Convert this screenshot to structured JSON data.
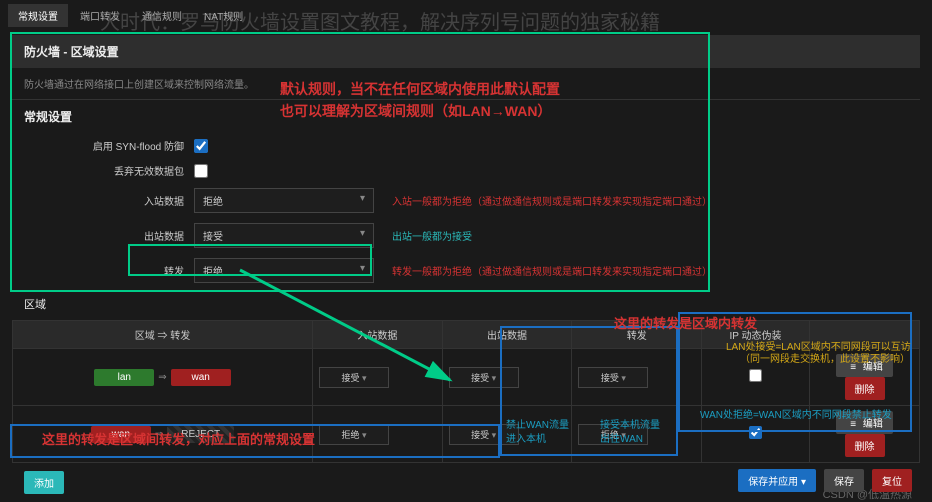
{
  "page_title_bg": "大时代：罗马防火墙设置图文教程，解决序列号问题的独家秘籍",
  "tabs": {
    "t0": "常规设置",
    "t1": "端口转发",
    "t2": "通信规则",
    "t3": "NAT规则"
  },
  "panel": {
    "title": "防火墙 - 区域设置",
    "desc": "防火墙通过在网络接口上创建区域来控制网络流量。"
  },
  "sub": "常规设置",
  "form": {
    "syn_label": "启用 SYN-flood 防御",
    "syn_checked": true,
    "drop_label": "丢弃无效数据包",
    "drop_checked": false,
    "in_label": "入站数据",
    "in_val": "拒绝",
    "out_label": "出站数据",
    "out_val": "接受",
    "fwd_label": "转发",
    "fwd_val": "拒绝"
  },
  "hints": {
    "in": "入站一般都为拒绝（通过做通信规则或是端口转发来实现指定端口通过）",
    "out": "出站一般都为接受",
    "fwd": "转发一般都为拒绝（通过做通信规则或是端口转发来实现指定端口通过）"
  },
  "anno_top1": "默认规则，当不在任何区域内使用此默认配置",
  "anno_top2": "也可以理解为区域间规则（如LAN→WAN）",
  "zone_hdr": "区域",
  "zone_th": {
    "fwd": "区域 ⇒ 转发",
    "in": "入站数据",
    "out": "出站数据",
    "fw": "转发",
    "ip": "IP 动态伪装"
  },
  "rows": [
    {
      "src": "lan",
      "dst": "wan",
      "in": "接受",
      "out": "接受",
      "fw": "接受",
      "masq": false
    },
    {
      "src": "wan",
      "dst": "REJECT",
      "in": "拒绝",
      "out": "接受",
      "fw": "拒绝",
      "masq": true
    }
  ],
  "btns": {
    "add": "添加",
    "edit": "编辑",
    "del": "删除",
    "save_apply": "保存并应用",
    "save": "保存",
    "reset": "复位"
  },
  "anno_zone_red": "这里的转发是区域内转发",
  "anno_lan1": "LAN处接受=LAN区域内不同网段可以互访",
  "anno_lan2": "（同一网段走交换机，此设置不影响）",
  "anno_bottom": "这里的转发是区域间转发，对应上面的常规设置",
  "anno_wan": "WAN处拒绝=WAN区域内不同网段禁止转发",
  "anno_wan_in1": "禁止WAN流量",
  "anno_wan_in2": "进入本机",
  "anno_wan_out1": "接受本机流量",
  "anno_wan_out2": "出往WAN",
  "watermark": "CSDN @低温热源"
}
